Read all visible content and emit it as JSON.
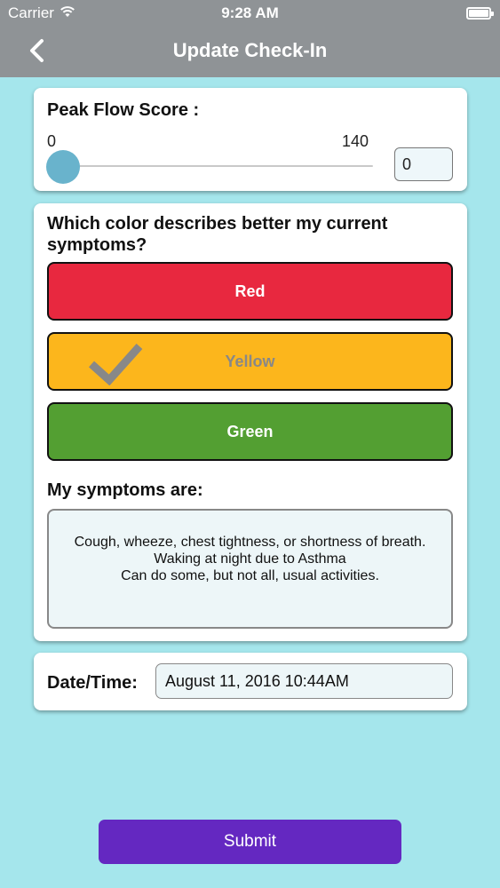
{
  "status_bar": {
    "carrier": "Carrier",
    "time": "9:28 AM"
  },
  "nav": {
    "title": "Update Check-In",
    "back_icon": "chevron-left-icon"
  },
  "peak_flow": {
    "heading": "Peak Flow Score :",
    "min_label": "0",
    "max_label": "140",
    "slider_value": 0,
    "value": "0"
  },
  "symptom_color": {
    "question": "Which color describes better my current symptoms?",
    "options": [
      {
        "label": "Red",
        "color": "#e8283f",
        "selected": false
      },
      {
        "label": "Yellow",
        "color": "#fcb61c",
        "selected": true
      },
      {
        "label": "Green",
        "color": "#539f32",
        "selected": false
      }
    ],
    "checkmark_icon": "checkmark-icon"
  },
  "symptoms": {
    "heading": "My symptoms are:",
    "lines": [
      "Cough, wheeze, chest tightness, or shortness of breath.",
      "Waking at night due to Asthma",
      "Can do some, but not all, usual activities."
    ]
  },
  "datetime": {
    "label": "Date/Time:",
    "value": "August 11, 2016 10:44AM"
  },
  "submit": {
    "label": "Submit",
    "color": "#6428c1"
  },
  "colors": {
    "background": "#a5e6ec",
    "nav_bar": "#8f9396",
    "slider_thumb": "#69b3cc"
  }
}
